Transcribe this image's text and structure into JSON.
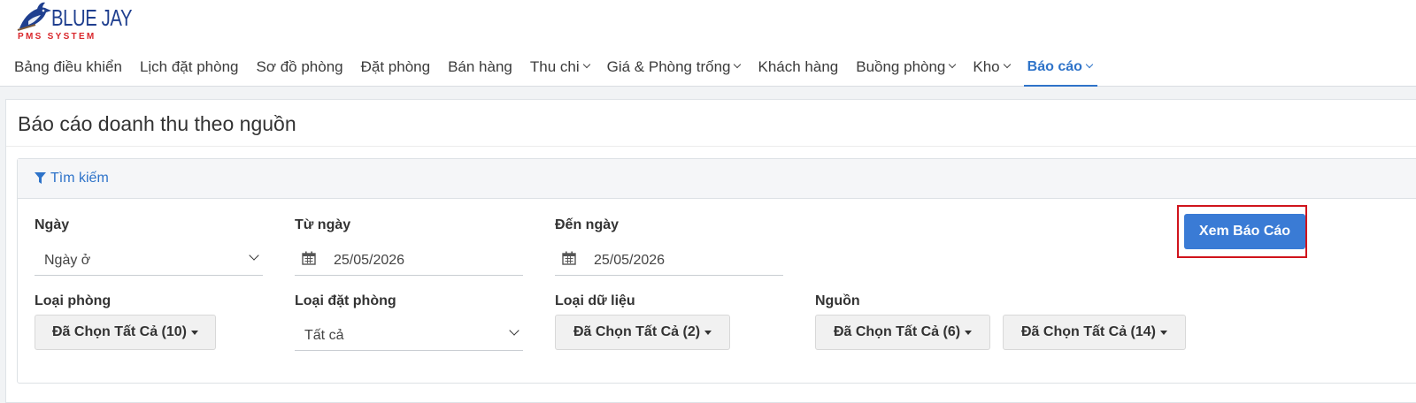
{
  "logo": {
    "name": "BLUE JAY",
    "subtitle": "PMS SYSTEM"
  },
  "nav": {
    "items": [
      {
        "label": "Bảng điều khiển",
        "dropdown": false,
        "active": false
      },
      {
        "label": "Lịch đặt phòng",
        "dropdown": false,
        "active": false
      },
      {
        "label": "Sơ đồ phòng",
        "dropdown": false,
        "active": false
      },
      {
        "label": "Đặt phòng",
        "dropdown": false,
        "active": false
      },
      {
        "label": "Bán hàng",
        "dropdown": false,
        "active": false
      },
      {
        "label": "Thu chi",
        "dropdown": true,
        "active": false
      },
      {
        "label": "Giá & Phòng trống",
        "dropdown": true,
        "active": false
      },
      {
        "label": "Khách hàng",
        "dropdown": false,
        "active": false
      },
      {
        "label": "Buồng phòng",
        "dropdown": true,
        "active": false
      },
      {
        "label": "Kho",
        "dropdown": true,
        "active": false
      },
      {
        "label": "Báo cáo",
        "dropdown": true,
        "active": true
      }
    ]
  },
  "page": {
    "title": "Báo cáo doanh thu theo nguồn"
  },
  "search": {
    "header": "Tìm kiếm",
    "date_type": {
      "label": "Ngày",
      "value": "Ngày ở"
    },
    "from_date": {
      "label": "Từ ngày",
      "value": "25/05/2026"
    },
    "to_date": {
      "label": "Đến ngày",
      "value": "25/05/2026"
    },
    "room_type": {
      "label": "Loại phòng",
      "value": "Đã Chọn Tất Cả (10)"
    },
    "booking_type": {
      "label": "Loại đặt phòng",
      "value": "Tất cả"
    },
    "data_type": {
      "label": "Loại dữ liệu",
      "value": "Đã Chọn Tất Cả (2)"
    },
    "source": {
      "label": "Nguồn",
      "value": "Đã Chọn Tất Cả (6)"
    },
    "source_detail": {
      "value": "Đã Chọn Tất Cả (14)"
    },
    "submit_label": "Xem Báo Cáo"
  },
  "colors": {
    "accent": "#2e73c9",
    "primary_button": "#3a7bd5",
    "highlight_border": "#d0141c",
    "logo_blue": "#1f3f8f",
    "logo_red": "#d9252a"
  }
}
